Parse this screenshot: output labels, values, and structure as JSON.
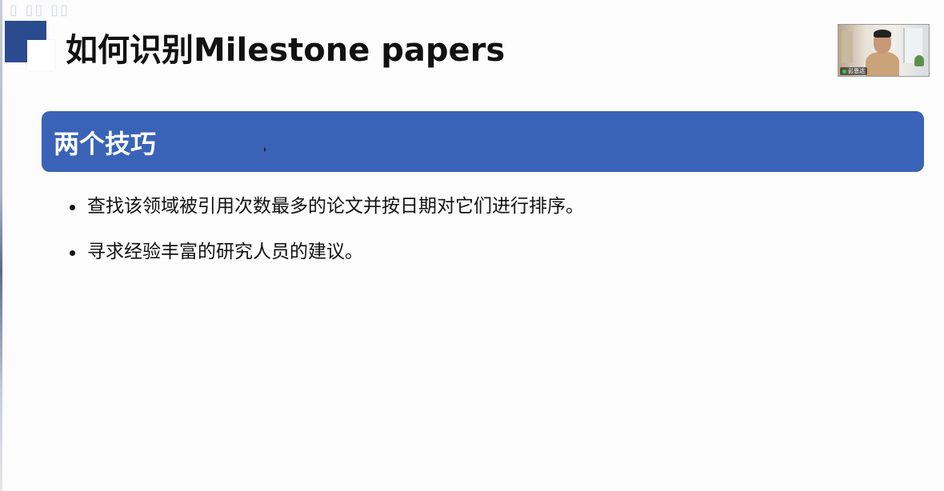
{
  "slide": {
    "title": "如何识别Milestone papers",
    "section_heading": "两个技巧",
    "bullets": [
      "查找该领域被引用次数最多的论文并按日期对它们进行排序。",
      "寻求经验丰富的研究人员的建议。"
    ]
  },
  "webcam": {
    "icon": "mic-icon",
    "name_tag": "彭恩达"
  },
  "colors": {
    "banner": "#3a63b8",
    "deco_blue": "#2b4b8f",
    "text": "#111111"
  }
}
